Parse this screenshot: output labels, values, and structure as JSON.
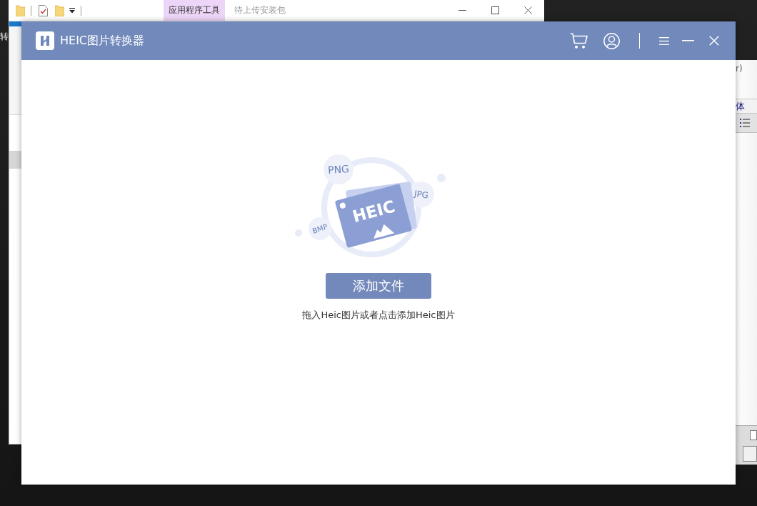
{
  "desktop": {
    "icon_label": "转"
  },
  "explorer_window": {
    "context_tab": "应用程序工具",
    "title": "待上传安装包"
  },
  "document_window": {
    "menu_text": "r)",
    "font_field": "体"
  },
  "app": {
    "title": "HEIC图片转换器",
    "header_icons": [
      {
        "kind": "cart"
      },
      {
        "kind": "account"
      },
      {
        "kind": "divider"
      },
      {
        "kind": "menu"
      },
      {
        "kind": "minimize"
      },
      {
        "kind": "close"
      }
    ]
  },
  "drop_zone": {
    "formats": [
      {
        "label": "PNG"
      },
      {
        "label": "JPG"
      },
      {
        "label": "BMP"
      }
    ],
    "badge": "HEIC",
    "button": "添加文件",
    "hint": "拖入Heic图片或者点击添加Heic图片"
  }
}
